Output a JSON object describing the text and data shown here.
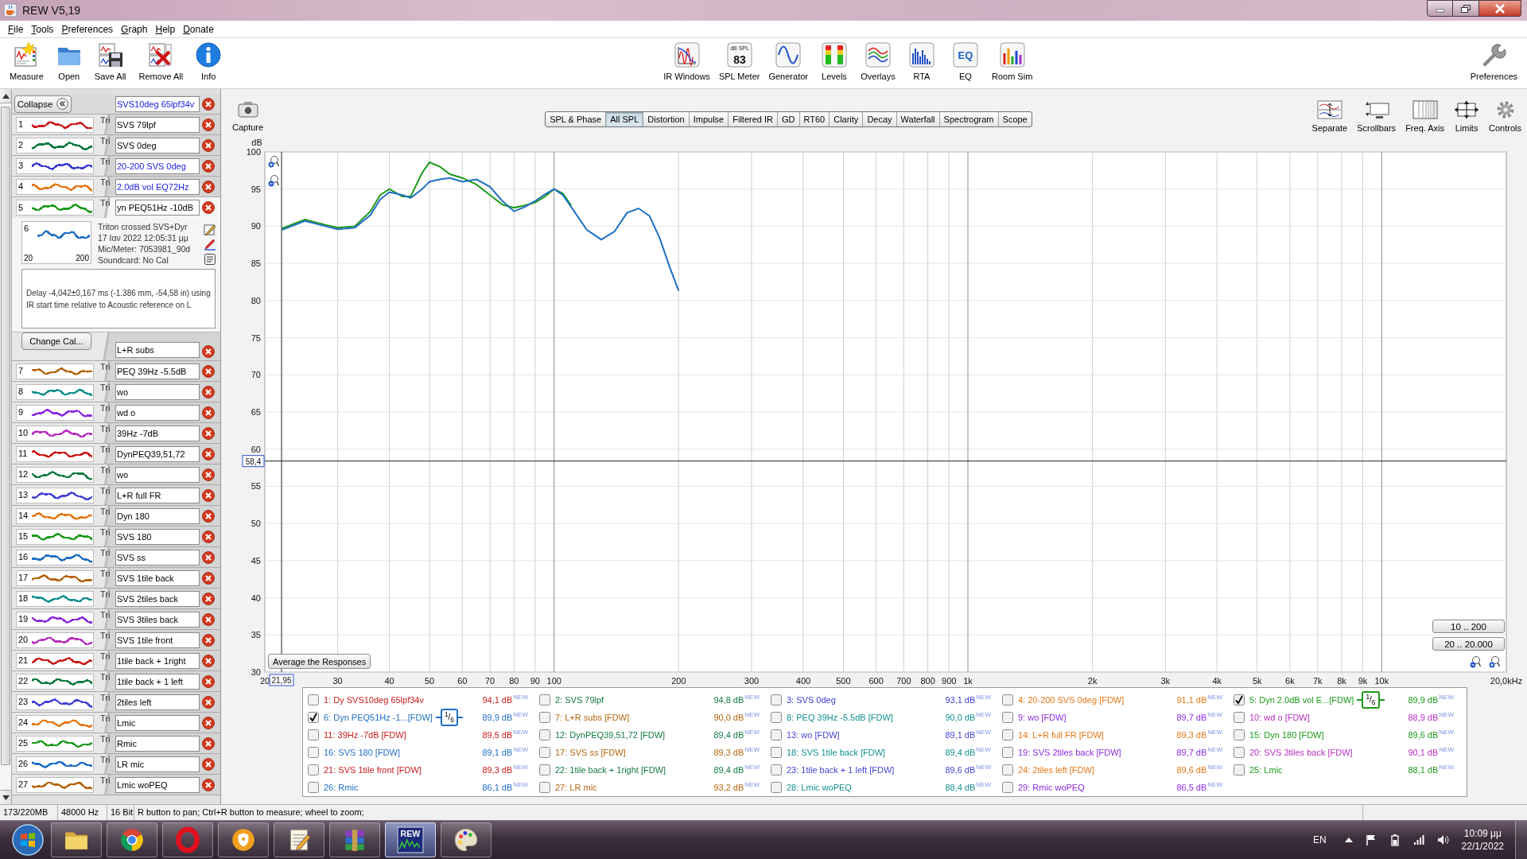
{
  "window": {
    "title": "REW V5,19"
  },
  "menu": [
    "File",
    "Tools",
    "Preferences",
    "Graph",
    "Help",
    "Donate"
  ],
  "toolbar": {
    "main": [
      {
        "label": "Measure",
        "kind": "measure"
      },
      {
        "label": "Open",
        "kind": "open"
      },
      {
        "label": "Save All",
        "kind": "save"
      },
      {
        "label": "Remove All",
        "kind": "remove"
      },
      {
        "label": "Info",
        "kind": "info"
      }
    ],
    "tools": [
      {
        "label": "IR Windows",
        "kind": "impulse"
      },
      {
        "label": "SPL Meter",
        "kind": "meter",
        "icon_text": [
          "dB SPL",
          "83"
        ]
      },
      {
        "label": "Generator",
        "kind": "generator"
      },
      {
        "label": "Levels",
        "kind": "levels"
      },
      {
        "label": "Overlays",
        "kind": "overlays"
      },
      {
        "label": "RTA",
        "kind": "rta"
      },
      {
        "label": "EQ",
        "kind": "eq",
        "icon_text": [
          "EQ"
        ]
      },
      {
        "label": "Room Sim",
        "kind": "roomsim"
      }
    ],
    "preferences": {
      "label": "Preferences",
      "kind": "preferences"
    }
  },
  "measurements": {
    "collapse": "Collapse",
    "items": [
      {
        "number": "1",
        "name_field": {
          "value": "SVS10deg 65lpf34v",
          "highlighted": true
        },
        "color": "#cc1a1a",
        "tab_text": "Tri",
        "expanded": false
      },
      {
        "number": "2",
        "name_field": {
          "value": "SVS 79lpf",
          "highlighted": false
        },
        "color": "#127a42",
        "tab_text": "Tri",
        "expanded": false
      },
      {
        "number": "3",
        "name_field": {
          "value": "SVS 0deg",
          "highlighted": false
        },
        "color": "#3b3bd0",
        "tab_text": "Tri",
        "expanded": false
      },
      {
        "number": "4",
        "name_field": {
          "value": "20-200 SVS 0deg",
          "highlighted": true
        },
        "color": "#e67817",
        "tab_text": "Tri",
        "expanded": false
      },
      {
        "number": "5",
        "name_field": {
          "value": "2.0dB vol EQ72Hz",
          "highlighted": true
        },
        "color": "#1c9a1c",
        "tab_text": "Tri",
        "expanded": false
      },
      {
        "number": "6",
        "name_field": {
          "value": "yn PEQ51Hz -10dB",
          "highlighted": false
        },
        "color": "#1f6fc4",
        "expanded": true,
        "details": {
          "graph_labels": [
            "20",
            "200"
          ],
          "lines": [
            "Triton crossed SVS+Dyr",
            "17 Ιαν 2022 12:05:31 μμ",
            "Mic/Meter: 7053981_90d",
            "Soundcard: No Cal"
          ],
          "note": "Delay -4,042±0,167 ms (-1.386 mm, -54,58 in) using IR start time relative to Acoustic reference on L",
          "button": "Change Cal..."
        }
      },
      {
        "number": "7",
        "name_field": {
          "value": "L+R subs",
          "highlighted": false
        },
        "color": "#b5650e",
        "tab_text": "Tri",
        "expanded": false
      },
      {
        "number": "8",
        "name_field": {
          "value": "PEQ 39Hz -5.5dB",
          "highlighted": false
        },
        "color": "#139090",
        "tab_text": "Tri",
        "expanded": false
      },
      {
        "number": "9",
        "name_field": {
          "value": "wo",
          "highlighted": false
        },
        "color": "#8a2be2",
        "tab_text": "Tri",
        "expanded": false
      },
      {
        "number": "10",
        "name_field": {
          "value": "wd o",
          "highlighted": false
        },
        "color": "#b82fc0",
        "tab_text": "Tri",
        "expanded": false
      },
      {
        "number": "11",
        "name_field": {
          "value": "39Hz -7dB",
          "highlighted": false
        },
        "color": "#cc1a1a",
        "tab_text": "Tri",
        "expanded": false
      },
      {
        "number": "12",
        "name_field": {
          "value": "DynPEQ39,51,72",
          "highlighted": false
        },
        "color": "#127a42",
        "tab_text": "Tri",
        "expanded": false
      },
      {
        "number": "13",
        "name_field": {
          "value": "wo",
          "highlighted": false
        },
        "color": "#4444d6",
        "tab_text": "Tri",
        "expanded": false
      },
      {
        "number": "14",
        "name_field": {
          "value": "L+R full FR",
          "highlighted": false
        },
        "color": "#e67817",
        "tab_text": "Tri",
        "expanded": false
      },
      {
        "number": "15",
        "name_field": {
          "value": "Dyn 180",
          "highlighted": false
        },
        "color": "#1c9a1c",
        "tab_text": "Tri",
        "expanded": false
      },
      {
        "number": "16",
        "name_field": {
          "value": "SVS 180",
          "highlighted": false
        },
        "color": "#1f6fc4",
        "tab_text": "Tri",
        "expanded": false
      },
      {
        "number": "17",
        "name_field": {
          "value": "SVS ss",
          "highlighted": false
        },
        "color": "#b5650e",
        "tab_text": "Tri",
        "expanded": false
      },
      {
        "number": "18",
        "name_field": {
          "value": "SVS 1tile back",
          "highlighted": false
        },
        "color": "#139090",
        "tab_text": "Tri",
        "expanded": false
      },
      {
        "number": "19",
        "name_field": {
          "value": "SVS 2tiles back",
          "highlighted": false
        },
        "color": "#8a2be2",
        "tab_text": "Tri",
        "expanded": false
      },
      {
        "number": "20",
        "name_field": {
          "value": "SVS 3tiles back",
          "highlighted": false
        },
        "color": "#b82fc0",
        "tab_text": "Tri",
        "expanded": false
      },
      {
        "number": "21",
        "name_field": {
          "value": "SVS 1tile front",
          "highlighted": false
        },
        "color": "#cc1a1a",
        "tab_text": "Tri",
        "expanded": false
      },
      {
        "number": "22",
        "name_field": {
          "value": "1tile back + 1right",
          "highlighted": false
        },
        "color": "#127a42",
        "tab_text": "Tri",
        "expanded": false
      },
      {
        "number": "23",
        "name_field": {
          "value": "1tile back + 1 left",
          "highlighted": false
        },
        "color": "#4444d6",
        "tab_text": "Tri",
        "expanded": false
      },
      {
        "number": "24",
        "name_field": {
          "value": "2tiles left",
          "highlighted": false
        },
        "color": "#e67817",
        "tab_text": "Tri",
        "expanded": false
      },
      {
        "number": "25",
        "name_field": {
          "value": "Lmic",
          "highlighted": false
        },
        "color": "#1c9a1c",
        "tab_text": "Tri",
        "expanded": false
      },
      {
        "number": "26",
        "name_field": {
          "value": "Rmic",
          "highlighted": false
        },
        "color": "#1f6fc4",
        "tab_text": "Tri",
        "expanded": false
      },
      {
        "number": "27",
        "name_field": {
          "value": "LR mic",
          "highlighted": false
        },
        "color": "#b5650e",
        "tab_text": "Tri",
        "expanded": false
      },
      {
        "name_field": {
          "value": "Lmic woPEQ",
          "highlighted": false
        },
        "expanded": false
      }
    ]
  },
  "graph": {
    "capture": "Capture",
    "tabs": [
      {
        "label": "SPL & Phase",
        "selected": false
      },
      {
        "label": "All SPL",
        "selected": true
      },
      {
        "label": "Distortion",
        "selected": false
      },
      {
        "label": "Impulse",
        "selected": false
      },
      {
        "label": "Filtered IR",
        "selected": false
      },
      {
        "label": "GD",
        "selected": false
      },
      {
        "label": "RT60",
        "selected": false
      },
      {
        "label": "Clarity",
        "selected": false
      },
      {
        "label": "Decay",
        "selected": false
      },
      {
        "label": "Waterfall",
        "selected": false
      },
      {
        "label": "Spectrogram",
        "selected": false
      },
      {
        "label": "Scope",
        "selected": false
      }
    ],
    "tools": [
      {
        "label": "Separate",
        "kind": "separate"
      },
      {
        "label": "Scrollbars",
        "kind": "scrollbars"
      },
      {
        "label": "Freq. Axis",
        "kind": "axis"
      },
      {
        "label": "Limits",
        "kind": "limits"
      },
      {
        "label": "Controls",
        "kind": "controls"
      }
    ],
    "chart_data": {
      "type": "line",
      "xlabel": "20,0kHz",
      "ylabel": "dB",
      "log": "x",
      "grid": true,
      "x": [
        22,
        25,
        28,
        30,
        33,
        36,
        38,
        40,
        43,
        45,
        48,
        50,
        53,
        56,
        60,
        65,
        70,
        75,
        80,
        85,
        90,
        95,
        100,
        105,
        110,
        120,
        130,
        140,
        150,
        160,
        170,
        180,
        190,
        200
      ],
      "series": [
        {
          "color": "#1c9a1c",
          "values": [
            89.7,
            90.9,
            90.2,
            89.8,
            90.0,
            92.0,
            94.2,
            95.0,
            94.0,
            94.0,
            97.2,
            98.6,
            98.0,
            97.0,
            96.5,
            95.6,
            94.2,
            92.9,
            92.5,
            92.8,
            93.2,
            94.0,
            95.0,
            94.4,
            92.8,
            null,
            null,
            null,
            null,
            null,
            null,
            null,
            null,
            null
          ]
        },
        {
          "color": "#1f6fc4",
          "values": [
            89.5,
            90.7,
            90.0,
            89.6,
            89.8,
            91.5,
            93.6,
            94.6,
            94.2,
            93.8,
            95.0,
            96.0,
            96.3,
            96.5,
            96.0,
            96.3,
            95.3,
            93.4,
            92.0,
            92.6,
            93.4,
            94.3,
            95.0,
            94.2,
            92.6,
            89.5,
            88.2,
            89.3,
            91.8,
            92.4,
            91.4,
            88.4,
            84.6,
            81.3
          ]
        }
      ],
      "xlim": [
        20,
        20000
      ],
      "ylim": [
        30,
        100
      ],
      "xticks": [
        20,
        30,
        40,
        50,
        60,
        70,
        80,
        90,
        100,
        200,
        300,
        400,
        500,
        600,
        700,
        800,
        900,
        {
          "value": 1000,
          "label": "1k"
        },
        {
          "value": 2000,
          "label": "2k"
        },
        {
          "value": 3000,
          "label": "3k"
        },
        {
          "value": 4000,
          "label": "4k"
        },
        {
          "value": 5000,
          "label": "5k"
        },
        {
          "value": 6000,
          "label": "6k"
        },
        {
          "value": 7000,
          "label": "7k"
        },
        {
          "value": 8000,
          "label": "8k"
        },
        {
          "value": 9000,
          "label": "9k"
        },
        {
          "value": 10000,
          "label": "10k"
        }
      ],
      "yticks": [
        30,
        35,
        40,
        45,
        50,
        55,
        60,
        65,
        70,
        75,
        80,
        85,
        90,
        95,
        100
      ],
      "ref_lines": [
        {
          "axis": "x",
          "value": 21.95,
          "label": "21,95"
        },
        {
          "axis": "y",
          "value": 58.4,
          "label": "58,4"
        }
      ]
    },
    "average_button": "Average the Responses",
    "range_buttons": [
      "10 .. 200",
      "20 .. 20.000"
    ],
    "legend": [
      {
        "label": "1: Dy SVS10deg 65lpf34v",
        "value": "94,1 dB",
        "tag": "NEW",
        "color": "#cc1a1a",
        "checked": false
      },
      {
        "label": "2: SVS 79lpf",
        "value": "94,8 dB",
        "tag": "NEW",
        "color": "#127a42",
        "checked": false
      },
      {
        "label": "3: SVS 0deg",
        "value": "93,1 dB",
        "tag": "NEW",
        "color": "#3b3bd0",
        "checked": false
      },
      {
        "label": "4: 20-200 SVS 0deg [FDW]",
        "value": "91,1 dB",
        "tag": "NEW",
        "color": "#e67817",
        "checked": false
      },
      {
        "label": "5: Dyn 2.0dB vol E...[FDW]",
        "value": "89,9 dB",
        "tag": "NEW",
        "color": "#1c9a1c",
        "checked": true,
        "smoothing": "$^{1}$/$_{6}$"
      },
      {
        "label": "6: Dyn PEQ51Hz -1...[FDW]",
        "value": "89,9 dB",
        "tag": "NEW",
        "color": "#1f6fc4",
        "checked": true,
        "smoothing": "$^{1}$/$_{6}$"
      },
      {
        "label": "7: L+R subs [FDW]",
        "value": "90,0 dB",
        "tag": "NEW",
        "color": "#b5650e",
        "checked": false
      },
      {
        "label": "8: PEQ 39Hz -5.5dB [FDW]",
        "value": "90,0 dB",
        "tag": "NEW",
        "color": "#139090",
        "checked": false
      },
      {
        "label": "9: wo [FDW]",
        "value": "89,7 dB",
        "tag": "NEW",
        "color": "#8a2be2",
        "checked": false
      },
      {
        "label": "10: wd o [FDW]",
        "value": "88,9 dB",
        "tag": "NEW",
        "color": "#b82fc0",
        "checked": false
      },
      {
        "label": "11: 39Hz -7dB [FDW]",
        "value": "89,5 dB",
        "tag": "NEW",
        "color": "#cc1a1a",
        "checked": false
      },
      {
        "label": "12: DynPEQ39,51,72 [FDW]",
        "value": "89,4 dB",
        "tag": "NEW",
        "color": "#127a42",
        "checked": false
      },
      {
        "label": "13: wo [FDW]",
        "value": "89,1 dB",
        "tag": "NEW",
        "color": "#4444d6",
        "checked": false
      },
      {
        "label": "14: L+R full FR [FDW]",
        "value": "89,3 dB",
        "tag": "NEW",
        "color": "#e67817",
        "checked": false
      },
      {
        "label": "15: Dyn 180 [FDW]",
        "value": "89,6 dB",
        "tag": "NEW",
        "color": "#1c9a1c",
        "checked": false
      },
      {
        "label": "16: SVS 180 [FDW]",
        "value": "89,1 dB",
        "tag": "NEW",
        "color": "#1f6fc4",
        "checked": false
      },
      {
        "label": "17: SVS ss [FDW]",
        "value": "89,3 dB",
        "tag": "NEW",
        "color": "#b5650e",
        "checked": false
      },
      {
        "label": "18: SVS 1tile back [FDW]",
        "value": "89,4 dB",
        "tag": "NEW",
        "color": "#139090",
        "checked": false
      },
      {
        "label": "19: SVS 2tiles back [FDW]",
        "value": "89,7 dB",
        "tag": "NEW",
        "color": "#8a2be2",
        "checked": false
      },
      {
        "label": "20: SVS 3tiles back [FDW]",
        "value": "90,1 dB",
        "tag": "NEW",
        "color": "#b82fc0",
        "checked": false
      },
      {
        "label": "21: SVS 1tile front [FDW]",
        "value": "89,3 dB",
        "tag": "NEW",
        "color": "#cc1a1a",
        "checked": false
      },
      {
        "label": "22: 1tile back + 1right [FDW]",
        "value": "89,4 dB",
        "tag": "NEW",
        "color": "#127a42",
        "checked": false
      },
      {
        "label": "23: 1tile back + 1 left [FDW]",
        "value": "89,6 dB",
        "tag": "NEW",
        "color": "#4444d6",
        "checked": false
      },
      {
        "label": "24: 2tiles left [FDW]",
        "value": "89,6 dB",
        "tag": "NEW",
        "color": "#e67817",
        "checked": false
      },
      {
        "label": "25: Lmic",
        "value": "88,1 dB",
        "tag": "NEW",
        "color": "#1c9a1c",
        "checked": false
      },
      {
        "label": "26: Rmic",
        "value": "86,1 dB",
        "tag": "NEW",
        "color": "#1f6fc4",
        "checked": false
      },
      {
        "label": "27: LR mic",
        "value": "93,2 dB",
        "tag": "NEW",
        "color": "#b5650e",
        "checked": false
      },
      {
        "label": "28: Lmic woPEQ",
        "value": "88,4 dB",
        "tag": "NEW",
        "color": "#139090",
        "checked": false
      },
      {
        "label": "29: Rmic woPEQ",
        "value": "86,5 dB",
        "tag": "NEW",
        "color": "#8a2be2",
        "checked": false
      }
    ]
  },
  "status_bar": [
    "173/220MB",
    "48000 Hz",
    "16 Bit",
    "R button to pan; Ctrl+R button to measure; wheel to zoom;"
  ],
  "taskbar": {
    "apps": [
      {
        "kind": "folder",
        "selected": false
      },
      {
        "kind": "chrome",
        "selected": false
      },
      {
        "kind": "opera",
        "selected": false
      },
      {
        "kind": "shield",
        "selected": false
      },
      {
        "kind": "notepad",
        "selected": false
      },
      {
        "kind": "archive",
        "selected": false
      },
      {
        "kind": "rew",
        "selected": true,
        "label": "REW"
      },
      {
        "kind": "paint",
        "selected": false
      }
    ],
    "language": "EN",
    "time": "10:09 μμ",
    "date": "22/1/2022"
  }
}
